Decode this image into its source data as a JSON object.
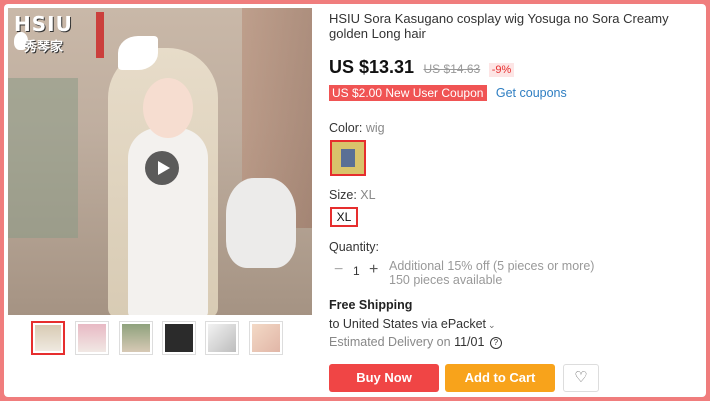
{
  "brand": {
    "logo_text": "HSIU",
    "logo_sub": "秀琴家"
  },
  "product": {
    "title": "HSIU Sora Kasugano cosplay wig Yosuga no Sora Creamy golden Long hair",
    "price": "US $13.31",
    "original_price": "US $14.63",
    "discount": "-9%",
    "coupon": "US $2.00 New User Coupon",
    "get_coupons": "Get coupons"
  },
  "options": {
    "color_label": "Color:",
    "color_value": "wig",
    "size_label": "Size:",
    "size_value": "XL",
    "size_button": "XL"
  },
  "quantity": {
    "label": "Quantity:",
    "minus": "−",
    "value": "1",
    "plus": "+",
    "note_line1": "Additional 15% off (5 pieces or more)",
    "note_line2": "150 pieces available"
  },
  "shipping": {
    "title": "Free Shipping",
    "destination": "to United States via ePacket",
    "delivery_label": "Estimated Delivery on",
    "delivery_date": "11/01",
    "help_glyph": "?"
  },
  "actions": {
    "buy_now": "Buy Now",
    "add_to_cart": "Add to Cart",
    "wishlist_icon": "♡"
  },
  "thumbnails": [
    "thumb-1",
    "thumb-2",
    "thumb-3",
    "thumb-4",
    "thumb-5",
    "thumb-6"
  ],
  "colors": {
    "accent": "#e62e2e",
    "buy": "#f04545",
    "cart": "#f8a31b",
    "link": "#2e7ec2",
    "frame": "#f07d7d"
  }
}
